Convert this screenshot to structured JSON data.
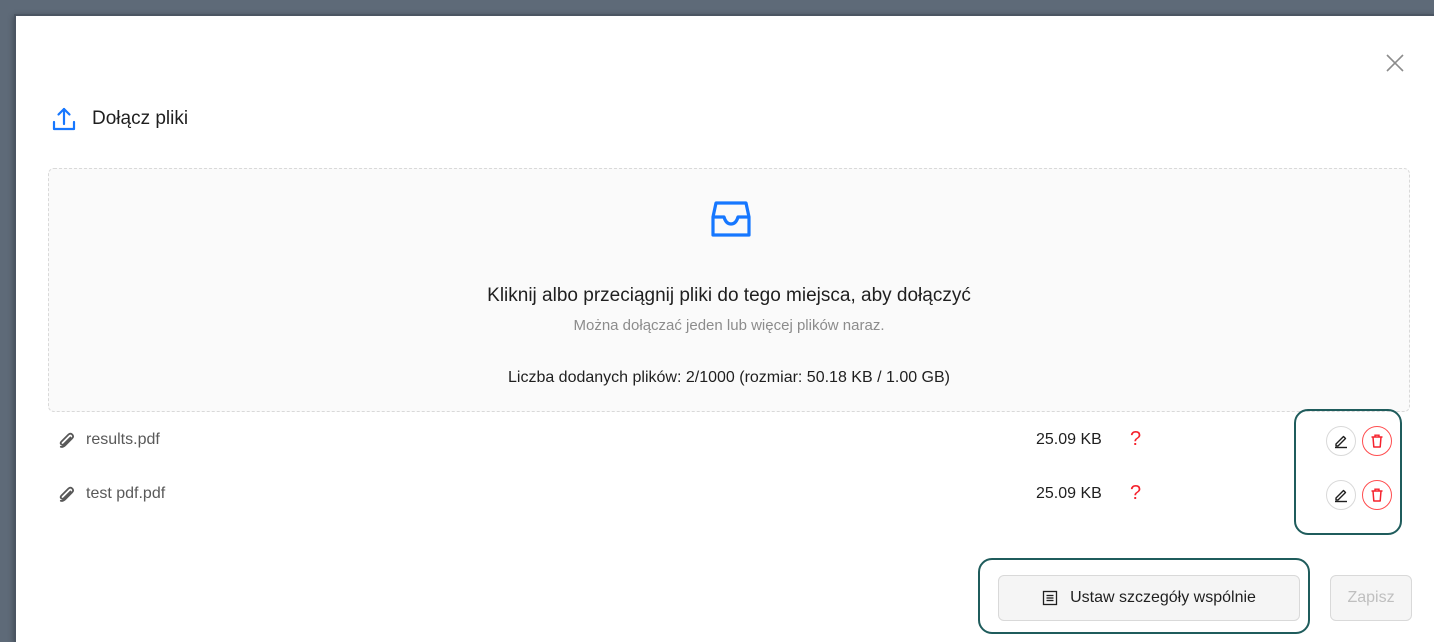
{
  "dialog": {
    "title": "Dołącz pliki"
  },
  "dropzone": {
    "main_text": "Kliknij albo przeciągnij pliki do tego miejsca, aby dołączyć",
    "hint_text": "Można dołączać jeden lub więcej plików naraz.",
    "count_text": "Liczba dodanych plików: 2/1000 (rozmiar: 50.18 KB / 1.00 GB)"
  },
  "files": [
    {
      "name": "results.pdf",
      "size": "25.09 KB",
      "status": "?"
    },
    {
      "name": "test pdf.pdf",
      "size": "25.09 KB",
      "status": "?"
    }
  ],
  "footer": {
    "shared_details_label": "Ustaw szczegóły wspólnie",
    "save_label": "Zapisz"
  },
  "colors": {
    "accent": "#1677ff",
    "danger": "#ff4d4f",
    "highlight": "#1f5c5c"
  },
  "icons": {
    "close": "close-icon",
    "upload": "upload-icon",
    "inbox": "inbox-icon",
    "attachment": "paperclip-icon",
    "edit": "pencil-icon",
    "delete": "trash-icon",
    "details": "list-icon"
  }
}
